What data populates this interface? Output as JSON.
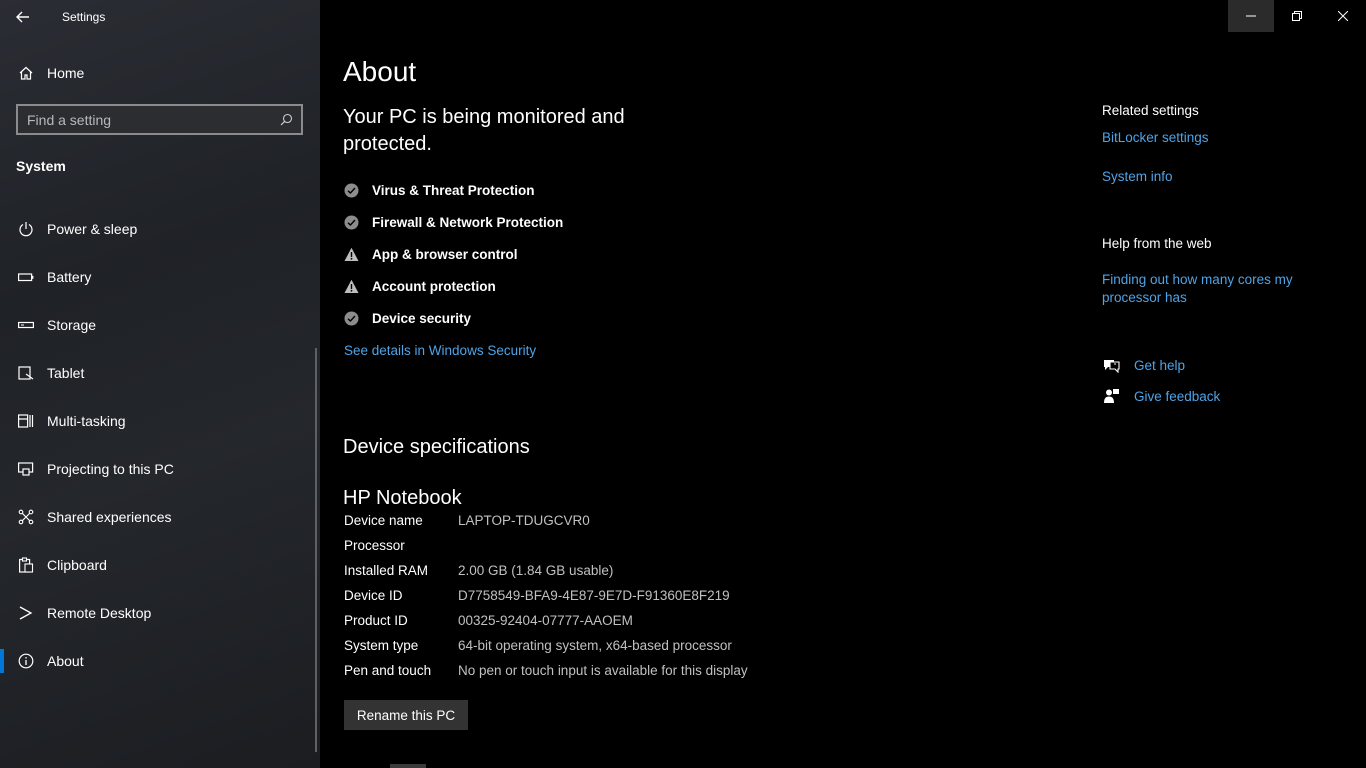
{
  "app": {
    "title": "Settings"
  },
  "sidebar": {
    "home_label": "Home",
    "search_placeholder": "Find a setting",
    "section_title": "System",
    "items": [
      {
        "label": "Power & sleep",
        "icon": "power-icon"
      },
      {
        "label": "Battery",
        "icon": "battery-icon"
      },
      {
        "label": "Storage",
        "icon": "storage-icon"
      },
      {
        "label": "Tablet",
        "icon": "tablet-icon"
      },
      {
        "label": "Multi-tasking",
        "icon": "multitasking-icon"
      },
      {
        "label": "Projecting to this PC",
        "icon": "projecting-icon"
      },
      {
        "label": "Shared experiences",
        "icon": "shared-experiences-icon"
      },
      {
        "label": "Clipboard",
        "icon": "clipboard-icon"
      },
      {
        "label": "Remote Desktop",
        "icon": "remote-desktop-icon"
      },
      {
        "label": "About",
        "icon": "info-icon",
        "active": true
      }
    ]
  },
  "main": {
    "title": "About",
    "monitor_headline": "Your PC is being monitored and protected.",
    "protections": [
      {
        "label": "Virus & Threat Protection",
        "status": "ok"
      },
      {
        "label": "Firewall & Network Protection",
        "status": "ok"
      },
      {
        "label": "App & browser control",
        "status": "warning"
      },
      {
        "label": "Account protection",
        "status": "warning"
      },
      {
        "label": "Device security",
        "status": "ok"
      }
    ],
    "see_details_link": "See details in Windows Security",
    "specs_header": "Device specifications",
    "device_model": "HP Notebook",
    "specs": [
      {
        "key": "Device name",
        "value": "LAPTOP-TDUGCVR0"
      },
      {
        "key": "Processor",
        "value": ""
      },
      {
        "key": "Installed RAM",
        "value": "2.00 GB (1.84 GB usable)"
      },
      {
        "key": "Device ID",
        "value": "D7758549-BFA9-4E87-9E7D-F91360E8F219"
      },
      {
        "key": "Product ID",
        "value": "00325-92404-07777-AAOEM"
      },
      {
        "key": "System type",
        "value": "64-bit operating system, x64-based processor"
      },
      {
        "key": "Pen and touch",
        "value": "No pen or touch input is available for this display"
      }
    ],
    "rename_button": "Rename this PC"
  },
  "right": {
    "related_heading": "Related settings",
    "bitlocker_link": "BitLocker settings",
    "system_info_link": "System info",
    "help_heading": "Help from the web",
    "cores_link": "Finding out how many cores my processor has",
    "get_help": "Get help",
    "give_feedback": "Give feedback"
  },
  "colors": {
    "accent": "#0078d7",
    "link": "#4fa3e6",
    "background": "#000000"
  }
}
